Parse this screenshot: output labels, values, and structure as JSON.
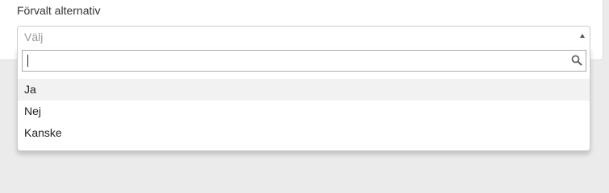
{
  "field": {
    "label": "Förvalt alternativ",
    "placeholder": "Välj"
  },
  "search": {
    "value": "",
    "icon": "search-icon"
  },
  "options": [
    {
      "label": "Ja",
      "highlighted": true
    },
    {
      "label": "Nej",
      "highlighted": false
    },
    {
      "label": "Kanske",
      "highlighted": false
    }
  ],
  "colors": {
    "background": "#ebebeb",
    "panel": "#ffffff",
    "highlight": "#f2f2f2",
    "border": "#cccccc"
  }
}
